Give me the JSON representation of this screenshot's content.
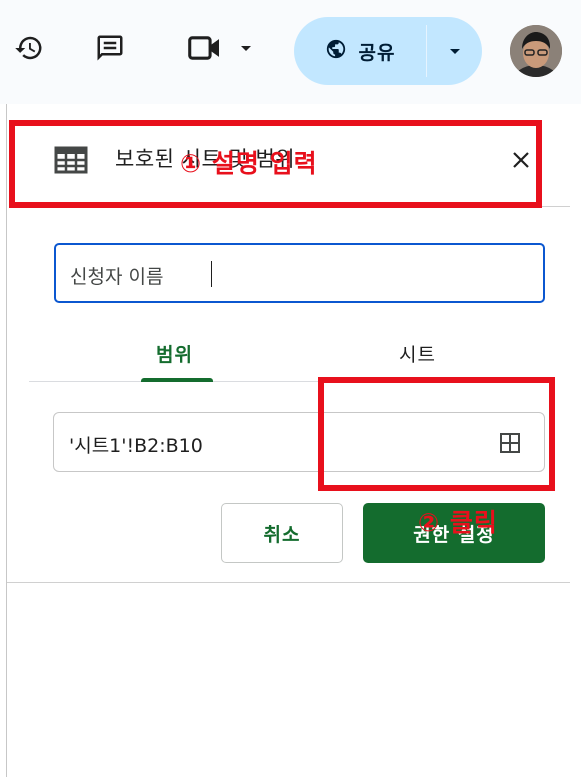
{
  "toolbar": {
    "share_label": "공유",
    "icons": [
      "history-icon",
      "comment-icon",
      "meet-icon",
      "globe-icon",
      "chevron-down-icon"
    ]
  },
  "panel": {
    "title": "보호된 시트 및 범위",
    "description_value": "신청자 이름",
    "tabs": [
      {
        "label": "범위",
        "active": true
      },
      {
        "label": "시트",
        "active": false
      }
    ],
    "range_value": "'시트1'!B2:B10",
    "cancel_label": "취소",
    "set_permissions_label": "권한 설정"
  },
  "annotations": {
    "step1": "① 설명 입력",
    "step2": "② 클릭",
    "color": "#e8101c"
  },
  "colors": {
    "accent_green": "#146c2e",
    "share_bg": "#c2e7ff",
    "focus_blue": "#0b57d0"
  }
}
